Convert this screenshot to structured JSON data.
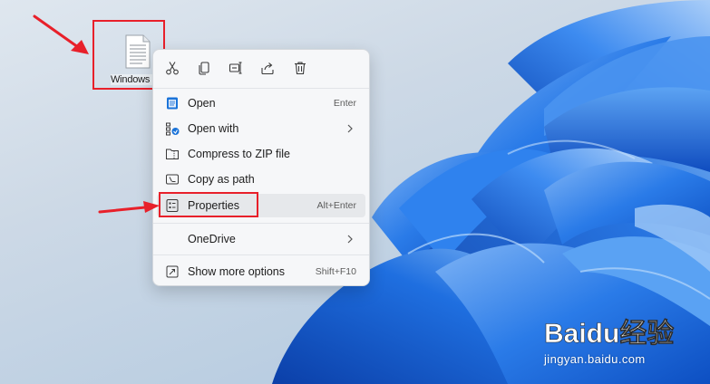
{
  "desktop": {
    "icon_label": "Windows",
    "icon_name": "text-file-icon"
  },
  "quick_actions": [
    {
      "name": "cut",
      "icon": "scissors-icon"
    },
    {
      "name": "copy",
      "icon": "copy-icon"
    },
    {
      "name": "rename",
      "icon": "rename-icon"
    },
    {
      "name": "share",
      "icon": "share-icon"
    },
    {
      "name": "delete",
      "icon": "trash-icon"
    }
  ],
  "menu": {
    "open": {
      "label": "Open",
      "shortcut": "Enter"
    },
    "open_with": {
      "label": "Open with"
    },
    "compress": {
      "label": "Compress to ZIP file"
    },
    "copy_path": {
      "label": "Copy as path"
    },
    "properties": {
      "label": "Properties",
      "shortcut": "Alt+Enter"
    },
    "onedrive": {
      "label": "OneDrive"
    },
    "more_options": {
      "label": "Show more options",
      "shortcut": "Shift+F10"
    }
  },
  "watermark": {
    "brand": "Baidu经验",
    "url": "jingyan.baidu.com"
  },
  "colors": {
    "annotation_red": "#e8202a",
    "wallpaper_blue": "#1f6fe0",
    "menu_bg": "#f6f7f9"
  }
}
